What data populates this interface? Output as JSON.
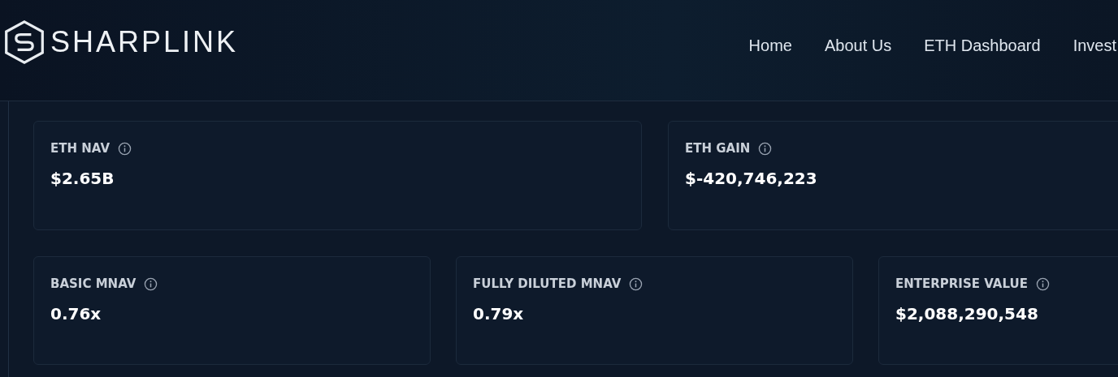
{
  "brand": {
    "name": "SHARPLINK"
  },
  "nav": [
    {
      "label": "Home"
    },
    {
      "label": "About Us"
    },
    {
      "label": "ETH Dashboard"
    },
    {
      "label": "Invest"
    }
  ],
  "metric_rows": [
    [
      {
        "label": "ETH NAV",
        "value": "$2.65B"
      },
      {
        "label": "ETH GAIN",
        "value": "$-420,746,223"
      }
    ],
    [
      {
        "label": "BASIC MNAV",
        "value": "0.76x"
      },
      {
        "label": "FULLY DILUTED MNAV",
        "value": "0.79x"
      },
      {
        "label": "ENTERPRISE VALUE",
        "value": "$2,088,290,548"
      }
    ]
  ]
}
